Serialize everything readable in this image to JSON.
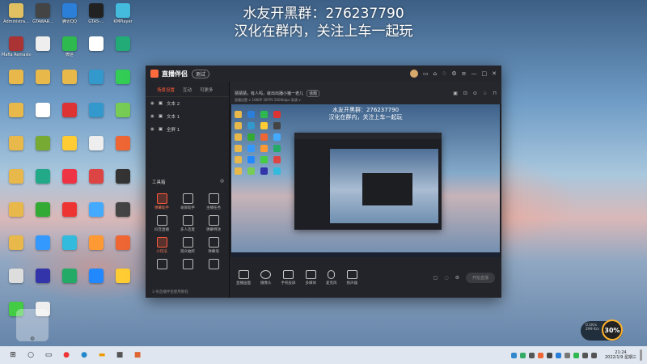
{
  "overlay": {
    "line1": "水友开黑群：276237790",
    "line2": "汉化在群内，关注上车一起玩"
  },
  "desktop_icons": [
    {
      "label": "Administra...",
      "icon": "user-folder-icon",
      "color": "#e0c060"
    },
    {
      "label": "GTAWAR...",
      "icon": "game-icon",
      "color": "#444"
    },
    {
      "label": "腾讯QQ",
      "icon": "qq-icon",
      "color": "#2b7fd8"
    },
    {
      "label": "GTA5-...",
      "icon": "game-icon",
      "color": "#222"
    },
    {
      "label": "KMPlayer",
      "icon": "player-icon",
      "color": "#4bd"
    },
    {
      "label": "Mafia Remaster...",
      "icon": "game-icon",
      "color": "#a33"
    },
    {
      "label": "",
      "icon": "file-icon",
      "color": "#eee"
    },
    {
      "label": "微信",
      "icon": "wechat-icon",
      "color": "#2db94d"
    },
    {
      "label": "",
      "icon": "file-icon",
      "color": "#fff"
    },
    {
      "label": "",
      "icon": "app-icon",
      "color": "#2a7"
    },
    {
      "label": "",
      "icon": "folder-icon",
      "color": "#e8b84a"
    },
    {
      "label": "",
      "icon": "folder-icon",
      "color": "#e8b84a"
    },
    {
      "label": "",
      "icon": "folder-icon",
      "color": "#e8b84a"
    },
    {
      "label": "",
      "icon": "app-icon",
      "color": "#39c"
    },
    {
      "label": "",
      "icon": "app-icon",
      "color": "#3c5"
    },
    {
      "label": "",
      "icon": "folder-icon",
      "color": "#e8b84a"
    },
    {
      "label": "",
      "icon": "file-icon",
      "color": "#fff"
    },
    {
      "label": "",
      "icon": "app-icon",
      "color": "#d33"
    },
    {
      "label": "",
      "icon": "app-icon",
      "color": "#39c"
    },
    {
      "label": "",
      "icon": "app-icon",
      "color": "#7c5"
    },
    {
      "label": "",
      "icon": "folder-icon",
      "color": "#e8b84a"
    },
    {
      "label": "",
      "icon": "app-icon",
      "color": "#7a3"
    },
    {
      "label": "",
      "icon": "app-icon",
      "color": "#fc3"
    },
    {
      "label": "",
      "icon": "file-icon",
      "color": "#eee"
    },
    {
      "label": "",
      "icon": "app-icon",
      "color": "#e63"
    },
    {
      "label": "",
      "icon": "folder-icon",
      "color": "#e8b84a"
    },
    {
      "label": "",
      "icon": "app-icon",
      "color": "#2a8"
    },
    {
      "label": "",
      "icon": "app-icon",
      "color": "#e34"
    },
    {
      "label": "",
      "icon": "app-icon",
      "color": "#d44"
    },
    {
      "label": "",
      "icon": "app-icon",
      "color": "#333"
    },
    {
      "label": "",
      "icon": "folder-icon",
      "color": "#e8b84a"
    },
    {
      "label": "",
      "icon": "app-icon",
      "color": "#3a3"
    },
    {
      "label": "",
      "icon": "app-icon",
      "color": "#e33"
    },
    {
      "label": "",
      "icon": "app-icon",
      "color": "#4af"
    },
    {
      "label": "",
      "icon": "app-icon",
      "color": "#444"
    },
    {
      "label": "",
      "icon": "folder-icon",
      "color": "#e8b84a"
    },
    {
      "label": "",
      "icon": "app-icon",
      "color": "#39f"
    },
    {
      "label": "",
      "icon": "app-icon",
      "color": "#3bd"
    },
    {
      "label": "",
      "icon": "app-icon",
      "color": "#f93"
    },
    {
      "label": "",
      "icon": "app-icon",
      "color": "#e63"
    },
    {
      "label": "",
      "icon": "file-icon",
      "color": "#ddd"
    },
    {
      "label": "",
      "icon": "app-icon",
      "color": "#33a"
    },
    {
      "label": "",
      "icon": "app-icon",
      "color": "#2a6"
    },
    {
      "label": "",
      "icon": "app-icon",
      "color": "#28f"
    },
    {
      "label": "",
      "icon": "app-icon",
      "color": "#fc3"
    },
    {
      "label": "",
      "icon": "app-icon",
      "color": "#4c4"
    },
    {
      "label": "",
      "icon": "file-icon",
      "color": "#eee"
    }
  ],
  "app": {
    "title": "直播伴侣",
    "version_badge": "测试",
    "sidebar": {
      "tabs": [
        "场景设置",
        "互动",
        "可更多"
      ],
      "scenes": [
        "文本 2",
        "文本 1",
        "全屏 1"
      ],
      "tools_title": "工具箱",
      "tools": [
        {
          "label": "弹幕助手",
          "hot": true
        },
        {
          "label": "录屏助手",
          "hot": false
        },
        {
          "label": "主播任务",
          "hot": false
        },
        {
          "label": "抖音直播",
          "hot": false
        },
        {
          "label": "多人连麦",
          "hot": false
        },
        {
          "label": "弹幕特效",
          "hot": false
        },
        {
          "label": "小玩法",
          "hot": true
        },
        {
          "label": "观众抽奖",
          "hot": false
        },
        {
          "label": "弹幕墙",
          "hot": false
        },
        {
          "label": "",
          "hot": false
        },
        {
          "label": "",
          "hot": false
        },
        {
          "label": "",
          "hot": false
        }
      ],
      "footer": "3 条直播伴侣使用教程"
    },
    "topbar": {
      "title": "猜猜猜，有人吗，就出出播小猪一老儿",
      "tag": "话题",
      "sub": "直播设置 ∨   1080P   30FPS   5000kbps   高清   ∨"
    },
    "preview": {
      "line1": "水友开黑群：276237790",
      "line2": "汉化在群内，关注上车一起玩"
    },
    "controls": [
      {
        "label": "直播画面",
        "icon": "screen-icon"
      },
      {
        "label": "摄像头",
        "icon": "camera-icon"
      },
      {
        "label": "手机投屏",
        "icon": "phone-icon"
      },
      {
        "label": "多媒体",
        "icon": "media-icon"
      },
      {
        "label": "麦克风",
        "icon": "mic-icon"
      },
      {
        "label": "扬声器",
        "icon": "speaker-icon"
      }
    ],
    "live_button": "开始直播"
  },
  "badge": {
    "speed_top": "0.1K/s",
    "speed_bottom": "299 K/s",
    "percent": "30%"
  },
  "taskbar": {
    "time": "21:24",
    "date": "2022/1/9 星期三"
  }
}
